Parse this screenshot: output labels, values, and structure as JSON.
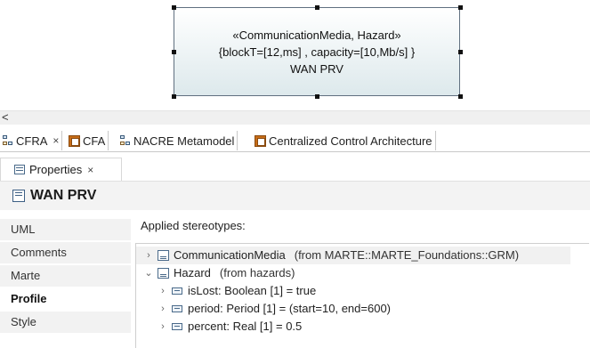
{
  "diagram": {
    "node": {
      "stereotypes": "«CommunicationMedia, Hazard»",
      "tagged_values": "{blockT=[12,ms] , capacity=[10,Mb/s] }",
      "name": "WAN PRV"
    }
  },
  "scrollbar": {
    "left_arrow": "<"
  },
  "editor_tabs": [
    {
      "label": "CFRA",
      "icon": "diagram-icon",
      "close": "×"
    },
    {
      "label": "CFA",
      "icon": "ibd-icon"
    },
    {
      "label": "NACRE Metamodel",
      "icon": "diagram-icon"
    },
    {
      "label": "Centralized Control Architecture",
      "icon": "ibd-icon"
    }
  ],
  "properties": {
    "tab_label": "Properties",
    "tab_close": "×",
    "title": "WAN PRV",
    "sidebar": [
      "UML",
      "Comments",
      "Marte",
      "Profile",
      "Style"
    ],
    "active_section": "Profile",
    "applied_label": "Applied stereotypes:",
    "tree": [
      {
        "expander": "›",
        "name": "CommunicationMedia",
        "from": "(from MARTE::MARTE_Foundations::GRM)"
      },
      {
        "expander": "⌄",
        "name": "Hazard",
        "from": "(from hazards)"
      },
      {
        "expander": "›",
        "text": "isLost: Boolean [1] = true"
      },
      {
        "expander": "›",
        "text": "period: Period [1] = (start=10, end=600)"
      },
      {
        "expander": "›",
        "text": "percent: Real [1] = 0.5"
      }
    ]
  },
  "colors": {
    "node_fill_bottom": "#dde9ec",
    "node_border": "#607080",
    "panel_bg": "#f3f3f3"
  }
}
